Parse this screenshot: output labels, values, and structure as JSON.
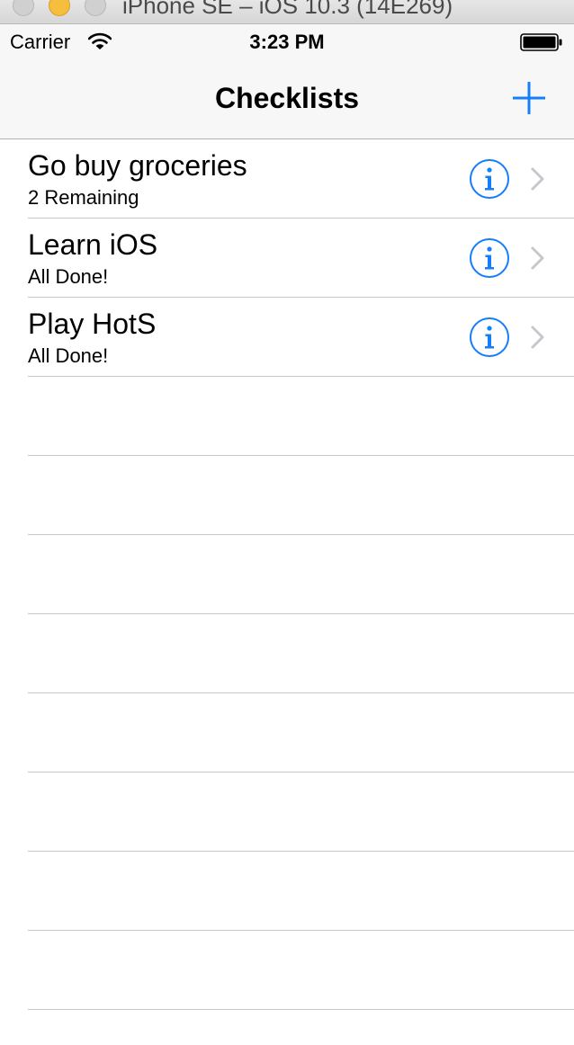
{
  "window": {
    "title": "iPhone SE – iOS 10.3 (14E269)"
  },
  "status_bar": {
    "carrier": "Carrier",
    "time": "3:23 PM"
  },
  "nav": {
    "title": "Checklists",
    "add_icon": "plus-icon"
  },
  "checklists": [
    {
      "title": "Go buy groceries",
      "subtitle": "2 Remaining"
    },
    {
      "title": "Learn iOS",
      "subtitle": "All Done!"
    },
    {
      "title": "Play HotS",
      "subtitle": "All Done!"
    }
  ],
  "colors": {
    "accent": "#157efb",
    "chevron": "#c7c7cc",
    "separator": "#c8c7cc",
    "bar_background": "#f7f7f7"
  }
}
